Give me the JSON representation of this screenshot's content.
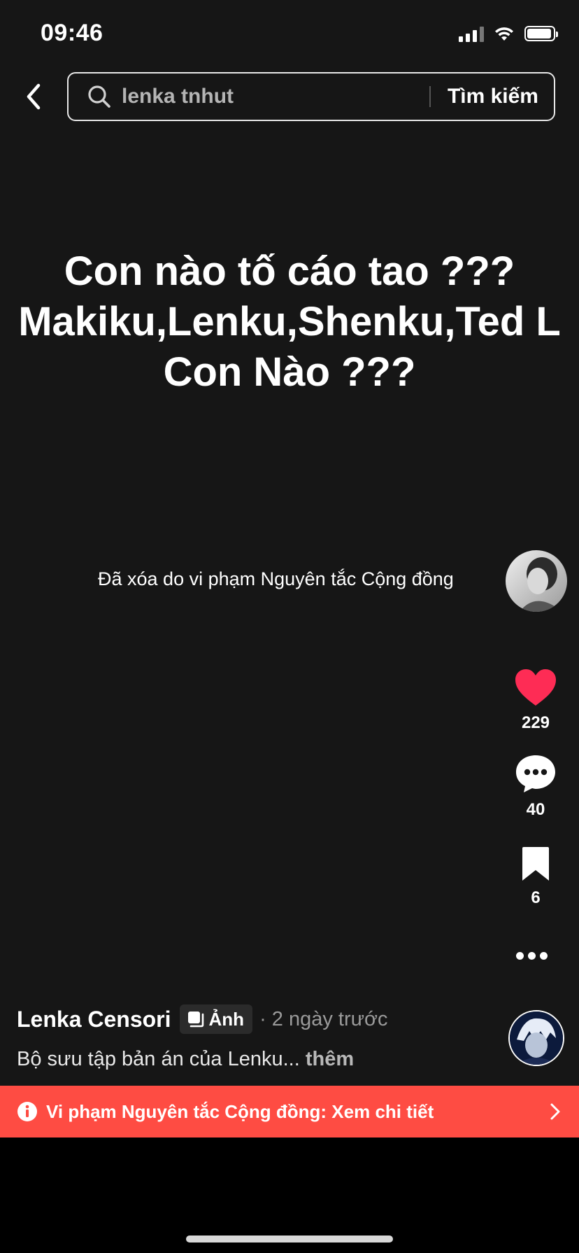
{
  "status_bar": {
    "time": "09:46"
  },
  "search": {
    "query": "lenka tnhut",
    "button_label": "Tìm kiếm"
  },
  "post": {
    "headline_lines": [
      "Con nào tố cáo tao ???",
      "Makiku,Lenku,Shenku,Ted L",
      "Con Nào ???"
    ],
    "removed_notice": "Đã xóa do vi phạm Nguyên tắc Cộng đồng",
    "likes": "229",
    "comments": "40",
    "saves": "6",
    "author": "Lenka Censori",
    "badge": "Ảnh",
    "time_ago": "· 2 ngày trước",
    "caption": "Bộ sưu tập bản án của Lenku...",
    "caption_more": "thêm"
  },
  "banner": {
    "text": "Vi phạm Nguyên tắc Cộng đồng: Xem chi tiết"
  },
  "colors": {
    "like": "#fe2c55",
    "banner": "#fe4c43",
    "background": "#161616"
  },
  "icons": [
    "back-arrow-icon",
    "search-icon",
    "heart-icon",
    "comment-icon",
    "bookmark-icon",
    "more-dots-icon",
    "photo-icon",
    "info-icon",
    "chevron-right-icon"
  ]
}
